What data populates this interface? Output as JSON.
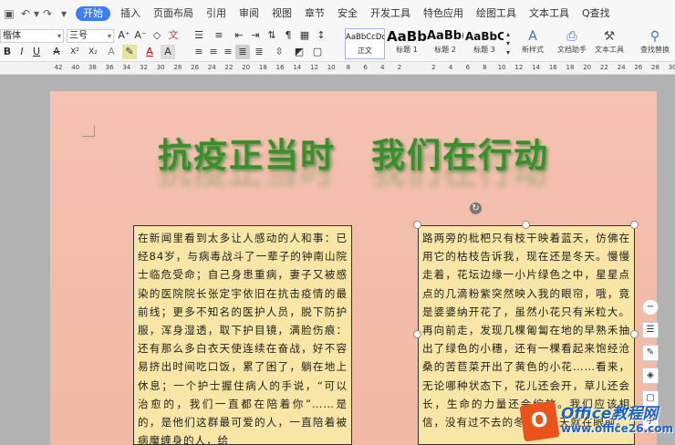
{
  "quick_access": {
    "save_icon": "save-icon",
    "undo": "↶",
    "redo": "↷",
    "more": "▾"
  },
  "tabs": [
    "开始",
    "插入",
    "页面布局",
    "引用",
    "审阅",
    "视图",
    "章节",
    "安全",
    "开发工具",
    "特色应用",
    "绘图工具",
    "文本工具"
  ],
  "search_label": "Q查找",
  "font": {
    "name": "楷体",
    "size": "三号"
  },
  "toolbar": {
    "grow": "A⁺",
    "shrink": "A⁻",
    "clear_format": "◇",
    "bold": "B",
    "italic": "I",
    "underline": "U",
    "strike": "A",
    "sup": "X²",
    "sub": "X₂",
    "font_color": "A",
    "highlight": "A"
  },
  "styles": [
    {
      "preview": "AaBbCcDd",
      "name": "正文"
    },
    {
      "preview": "AaBb",
      "name": "标题 1"
    },
    {
      "preview": "AaBb(",
      "name": "标题 2"
    },
    {
      "preview": "AaBbC(",
      "name": "标题 3"
    }
  ],
  "ribbon_buttons": {
    "new_style": "新样式",
    "doc_assistant": "文档助手",
    "text_tools": "文本工具",
    "find_replace": "查找替换"
  },
  "ruler_ticks": [
    "42",
    "40",
    "38",
    "36",
    "34",
    "32",
    "30",
    "28",
    "26",
    "24",
    "22",
    "20",
    "18",
    "16",
    "14",
    "12",
    "10",
    "8",
    "6",
    "4",
    "2",
    "",
    "2",
    "4",
    "6",
    "8",
    "10",
    "12",
    "14",
    "16",
    "18",
    "20",
    "22",
    "24",
    "26",
    "28",
    "30"
  ],
  "document": {
    "title": "抗疫正当时　我们在行动",
    "box1": "在新闻里看到太多让人感动的人和事：已经84岁，与病毒战斗了一辈子的钟南山院士临危受命；自己身患重病，妻子又被感染的医院院长张定宇依旧在抗击疫情的最前线；更多不知名的医护人员，脱下防护服，浑身湿透，取下护目镜，满脸伤痕：还有那么多白衣天使连续在奋战，好不容易挤出时间吃口饭，累了困了，躺在地上休息；一个护士握住病人的手说，“可以治愈的，我们一直都在陪着你”……是的，是他们这群最可爱的人，一直陪着被病魔缠身的人，给",
    "box2": "路两旁的枇杷只有枝干映着蓝天，仿佛在用它的枯枝告诉我，现在还是冬天。慢慢走着，花坛边缘一小片绿色之中，星星点点的几滴粉紫突然映入我的眼帘，哦，竟是婆婆纳开花了，虽然小花只有米粒大。再向前走，发现几棵匍匐在地的早熟禾抽出了绿色的小穗，还有一棵看起来饱经沧桑的苦苣菜开出了黄色的小花……看来，无论哪种状态下，花儿还会开，草儿还会长，生命的力量还会绽放。我们应该相信，没有过不去的冬天，春天就在眼前。"
  },
  "side_tools": [
    "−",
    "☰",
    "✎",
    "◈",
    "▢",
    "字"
  ],
  "watermark": {
    "brand": "Office教程网",
    "url": "www.office26.com",
    "logo_char": "O"
  }
}
